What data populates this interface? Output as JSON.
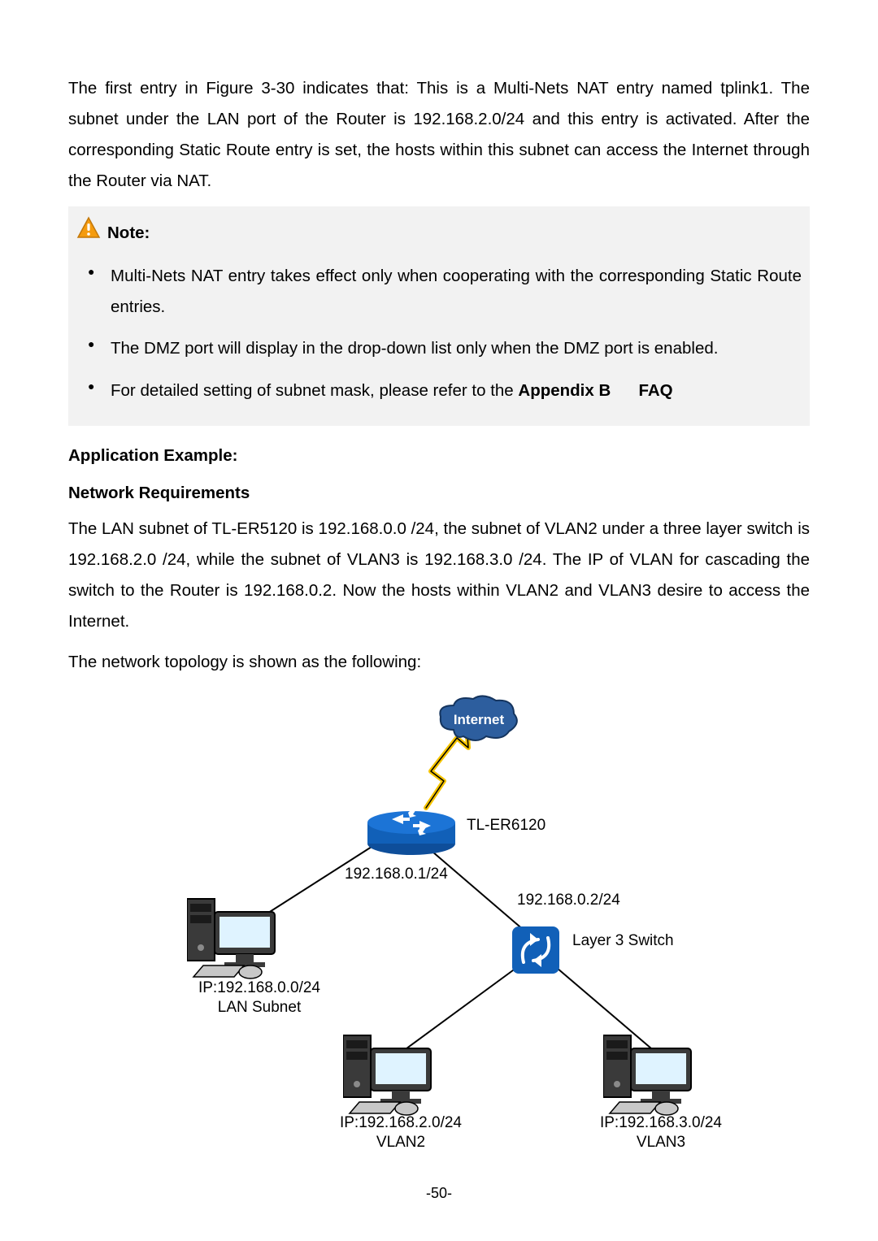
{
  "intro_para": "The first entry in Figure 3-30 indicates that: This is a Multi-Nets NAT entry named tplink1. The subnet under the LAN port of the Router is 192.168.2.0/24 and this entry is activated. After the corresponding Static Route entry is set, the hosts within this subnet can access the Internet through the Router via NAT.",
  "note": {
    "heading": "Note:",
    "items": [
      "Multi-Nets NAT entry takes effect only when cooperating with the corresponding Static Route entries.",
      "The DMZ port will display in the drop-down list only when the DMZ port is enabled."
    ],
    "item3_pre": "For detailed setting of subnet mask, please refer to the ",
    "item3_b1": "Appendix B",
    "item3_gap": "      ",
    "item3_b2": "FAQ"
  },
  "app_example": "Application Example:",
  "net_req": "Network Requirements",
  "net_req_para": "The LAN subnet of TL-ER5120 is 192.168.0.0 /24, the subnet of VLAN2 under a three layer switch is 192.168.2.0 /24, while the subnet of VLAN3 is 192.168.3.0 /24. The IP of VLAN for cascading the switch to the Router is 192.168.0.2. Now the hosts within VLAN2 and VLAN3 desire to access the Internet.",
  "topo_intro": "The network topology is shown as the following:",
  "fig": {
    "internet": "Internet",
    "router_model": "TL-ER6120",
    "router_ip": "192.168.0.1/24",
    "switch_ip": "192.168.0.2/24",
    "switch_label": "Layer 3 Switch",
    "lan_ip": "IP:192.168.0.0/24",
    "lan_name": "LAN Subnet",
    "vlan2_ip": "IP:192.168.2.0/24",
    "vlan2_name": "VLAN2",
    "vlan3_ip": "IP:192.168.3.0/24",
    "vlan3_name": "VLAN3"
  },
  "page_number": "-50-"
}
